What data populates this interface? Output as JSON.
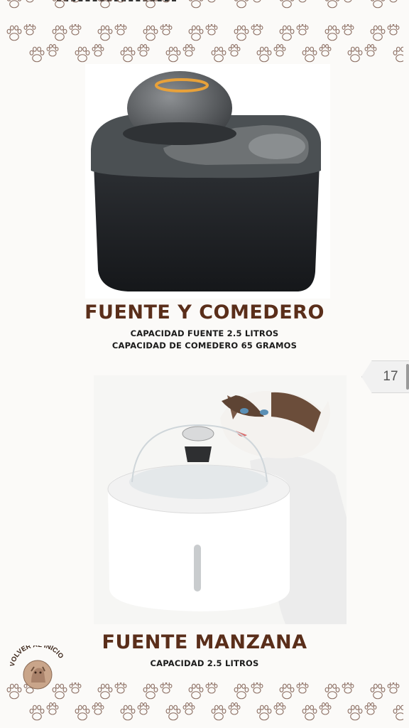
{
  "colors": {
    "title_brown": "#5a2e1a",
    "caption_black": "#1b1b1b",
    "paw_outline": "#8b6e62",
    "background": "#fbfaf8"
  },
  "products": [
    {
      "title": "FUENTE Y COMEDERO",
      "details": [
        "CAPACIDAD FUENTE 2.5 LITROS",
        "CAPACIDAD DE COMEDERO 65 GRAMOS"
      ]
    },
    {
      "title": "FUENTE MANZANA",
      "details": [
        "CAPACIDAD 2.5 LITROS"
      ]
    }
  ],
  "page_number": "17",
  "home_link": {
    "label": "VOLVER AL INICIO",
    "icon": "dog-avatar-icon"
  },
  "decor": {
    "pattern_icon": "paw-print-icon"
  }
}
